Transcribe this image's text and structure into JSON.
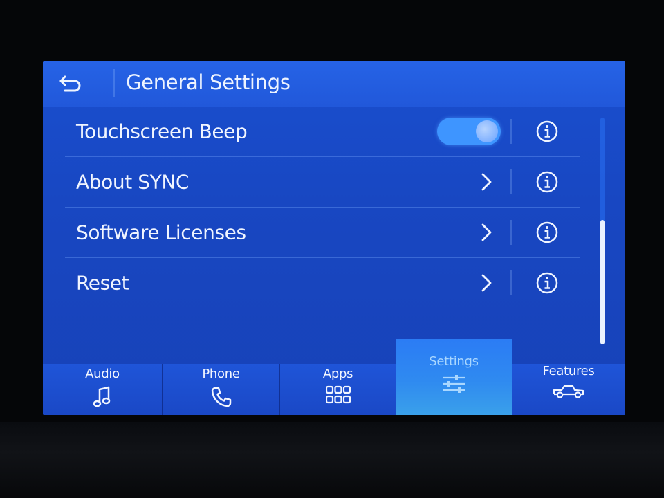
{
  "header": {
    "title": "General Settings"
  },
  "rows": [
    {
      "label": "Touchscreen Beep",
      "control": "toggle",
      "toggle_on": true
    },
    {
      "label": "About SYNC",
      "control": "chevron"
    },
    {
      "label": "Software Licenses",
      "control": "chevron"
    },
    {
      "label": "Reset",
      "control": "chevron"
    }
  ],
  "tabs": [
    {
      "label": "Audio",
      "icon": "music-note-icon"
    },
    {
      "label": "Phone",
      "icon": "phone-icon"
    },
    {
      "label": "Apps",
      "icon": "apps-grid-icon"
    },
    {
      "label": "Settings",
      "icon": "sliders-icon",
      "active": true
    },
    {
      "label": "Features",
      "icon": "truck-icon"
    }
  ],
  "colors": {
    "accent": "#3e95ff",
    "active_tab_underline": "#38e0d6",
    "background": "#1847c2"
  }
}
